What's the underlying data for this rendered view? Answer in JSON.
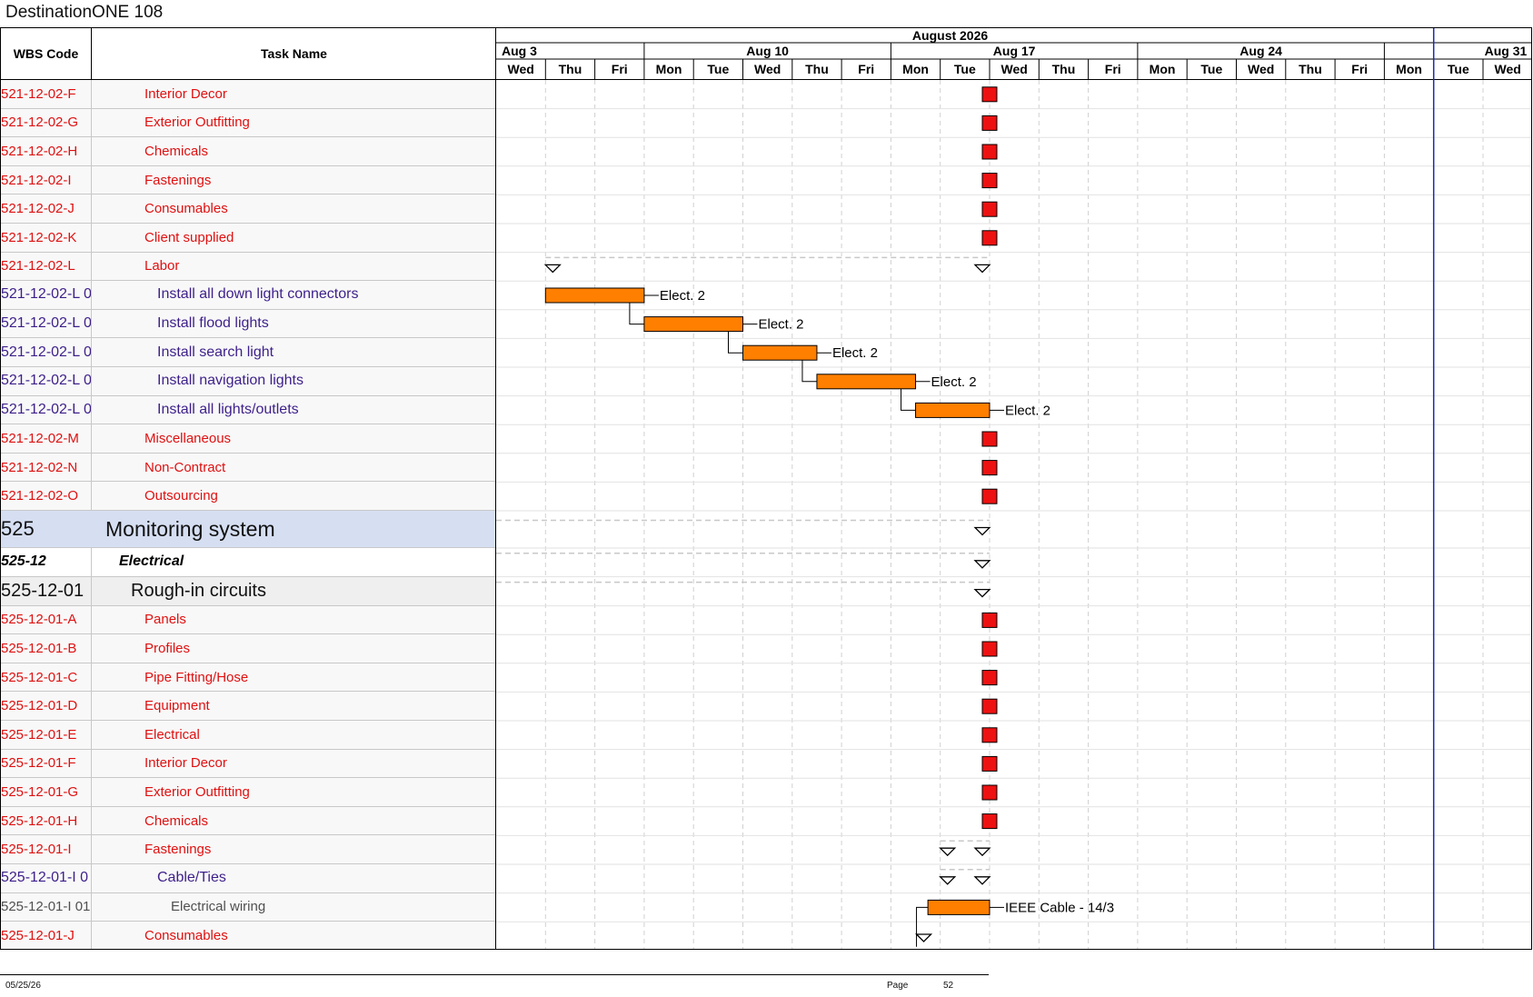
{
  "app": {
    "title": "DestinationONE 108"
  },
  "columns": {
    "wbs": "WBS Code",
    "task": "Task Name"
  },
  "timeline": {
    "month": "August 2026",
    "weeks": [
      "Aug 3",
      "Aug 10",
      "Aug 17",
      "Aug 24",
      "Aug 31"
    ],
    "days": [
      "Wed",
      "Thu",
      "Fri",
      "Mon",
      "Tue",
      "Wed",
      "Thu",
      "Fri",
      "Mon",
      "Tue",
      "Wed",
      "Thu",
      "Fri",
      "Mon",
      "Tue",
      "Wed",
      "Thu",
      "Fri",
      "Mon",
      "Tue",
      "Wed"
    ]
  },
  "rows": [
    {
      "wbs": "521-12-02-F",
      "task": "Interior Decor",
      "level": "task",
      "kind": "milestone",
      "day": 10
    },
    {
      "wbs": "521-12-02-G",
      "task": "Exterior Outfitting",
      "level": "task",
      "kind": "milestone",
      "day": 10
    },
    {
      "wbs": "521-12-02-H",
      "task": "Chemicals",
      "level": "task",
      "kind": "milestone",
      "day": 10
    },
    {
      "wbs": "521-12-02-I",
      "task": "Fastenings",
      "level": "task",
      "kind": "milestone",
      "day": 10
    },
    {
      "wbs": "521-12-02-J",
      "task": "Consumables",
      "level": "task",
      "kind": "milestone",
      "day": 10
    },
    {
      "wbs": "521-12-02-K",
      "task": "Client supplied",
      "level": "task",
      "kind": "milestone",
      "day": 10
    },
    {
      "wbs": "521-12-02-L",
      "task": "Labor",
      "level": "task",
      "kind": "summary",
      "start": 1,
      "end": 10
    },
    {
      "wbs": "521-12-02-L 0",
      "task": "Install all down light connectors",
      "level": "sub",
      "kind": "bar",
      "start": 1,
      "end": 3,
      "label": "Elect. 2"
    },
    {
      "wbs": "521-12-02-L 0",
      "task": "Install flood lights",
      "level": "sub",
      "kind": "bar",
      "start": 3,
      "end": 5,
      "label": "Elect. 2"
    },
    {
      "wbs": "521-12-02-L 0",
      "task": "Install search light",
      "level": "sub",
      "kind": "bar",
      "start": 5,
      "end": 6.5,
      "label": "Elect. 2"
    },
    {
      "wbs": "521-12-02-L 0",
      "task": "Install navigation lights",
      "level": "sub",
      "kind": "bar",
      "start": 6.5,
      "end": 8.5,
      "label": "Elect. 2"
    },
    {
      "wbs": "521-12-02-L 0",
      "task": "Install all lights/outlets",
      "level": "sub",
      "kind": "bar",
      "start": 8.5,
      "end": 10,
      "label": "Elect. 2"
    },
    {
      "wbs": "521-12-02-M",
      "task": "Miscellaneous",
      "level": "task",
      "kind": "milestone",
      "day": 10
    },
    {
      "wbs": "521-12-02-N",
      "task": "Non-Contract",
      "level": "task",
      "kind": "milestone",
      "day": 10
    },
    {
      "wbs": "521-12-02-O",
      "task": "Outsourcing",
      "level": "task",
      "kind": "milestone",
      "day": 10
    },
    {
      "wbs": "525",
      "task": "Monitoring system",
      "level": "l1",
      "kind": "summary",
      "start": 0,
      "end": 10
    },
    {
      "wbs": "525-12",
      "task": "Electrical",
      "level": "l2",
      "kind": "summary",
      "start": 0,
      "end": 10
    },
    {
      "wbs": "525-12-01",
      "task": "Rough-in circuits",
      "level": "l3",
      "kind": "summary",
      "start": 0,
      "end": 10
    },
    {
      "wbs": "525-12-01-A",
      "task": "Panels",
      "level": "task",
      "kind": "milestone",
      "day": 10
    },
    {
      "wbs": "525-12-01-B",
      "task": "Profiles",
      "level": "task",
      "kind": "milestone",
      "day": 10
    },
    {
      "wbs": "525-12-01-C",
      "task": "Pipe Fitting/Hose",
      "level": "task",
      "kind": "milestone",
      "day": 10
    },
    {
      "wbs": "525-12-01-D",
      "task": "Equipment",
      "level": "task",
      "kind": "milestone",
      "day": 10
    },
    {
      "wbs": "525-12-01-E",
      "task": "Electrical",
      "level": "task",
      "kind": "milestone",
      "day": 10
    },
    {
      "wbs": "525-12-01-F",
      "task": "Interior Decor",
      "level": "task",
      "kind": "milestone",
      "day": 10
    },
    {
      "wbs": "525-12-01-G",
      "task": "Exterior Outfitting",
      "level": "task",
      "kind": "milestone",
      "day": 10
    },
    {
      "wbs": "525-12-01-H",
      "task": "Chemicals",
      "level": "task",
      "kind": "milestone",
      "day": 10
    },
    {
      "wbs": "525-12-01-I",
      "task": "Fastenings",
      "level": "task",
      "kind": "summary",
      "start": 9,
      "end": 10
    },
    {
      "wbs": "525-12-01-I 0",
      "task": "Cable/Ties",
      "level": "sub",
      "kind": "summary",
      "start": 9,
      "end": 10
    },
    {
      "wbs": "525-12-01-I 01",
      "task": "Electrical wiring",
      "level": "item",
      "kind": "bar",
      "start": 8.75,
      "end": 10,
      "label": "IEEE Cable - 14/3"
    },
    {
      "wbs": "525-12-01-J",
      "task": "Consumables",
      "level": "task",
      "kind": "summary-start",
      "start": 8.5,
      "end": 8.5
    }
  ],
  "colors": {
    "bar": "#ff7f00",
    "milestone": "#ee1111",
    "today": "#1a2bb8",
    "summary_bg": "#d6dff2"
  },
  "footer": {
    "date": "05/25/26",
    "page_label": "Page",
    "page_number": "52"
  }
}
